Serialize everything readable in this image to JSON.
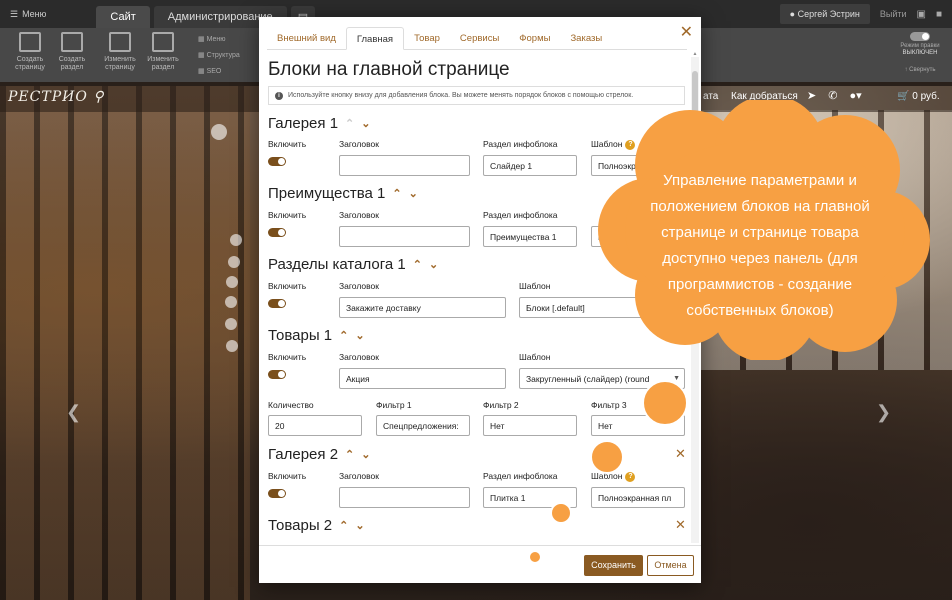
{
  "topbar": {
    "menu_label": "Меню",
    "tabs": [
      {
        "label": "Сайт",
        "active": true
      },
      {
        "label": "Администрирование",
        "active": false
      }
    ],
    "user": "Сергей Эстрин",
    "exit": "Выйти"
  },
  "toolbar": {
    "create_page": "Создать страницу",
    "create_section": "Создать раздел",
    "edit_page": "Изменить страницу",
    "edit_section": "Изменить раздел",
    "menu": "Меню",
    "structure": "Структура",
    "seo": "SEO",
    "edit_mode": "Режим правки",
    "edit_mode_state": "ВЫКЛЮЧЕН",
    "collapse": "Свернуть"
  },
  "site": {
    "logo": "РЕСТРИО",
    "nav_fragment": "ата",
    "nav_link": "Как добраться",
    "cart": "0 руб."
  },
  "modal": {
    "tabs": [
      "Внешний вид",
      "Главная",
      "Товар",
      "Сервисы",
      "Формы",
      "Заказы"
    ],
    "active_tab": "Главная",
    "title": "Блоки на главной странице",
    "info": "Используйте кнопку внизу для добавления блока. Вы можете менять порядок блоков с помощью стрелок.",
    "labels": {
      "enable": "Включить",
      "header": "Заголовок",
      "infoblock": "Раздел инфоблока",
      "template": "Шаблон",
      "quantity": "Количество",
      "filter1": "Фильтр 1",
      "filter2": "Фильтр 2",
      "filter3": "Фильтр 3"
    },
    "blocks": [
      {
        "name": "Галерея 1",
        "header": "",
        "infoblock": "Слайдер 1",
        "template": "Полноэкранн"
      },
      {
        "name": "Преимущества 1",
        "header": "",
        "infoblock": "Преимущества 1",
        "template": "П"
      },
      {
        "name": "Разделы каталога 1",
        "header": "Закажите доставку",
        "template": "Блоки [.default]"
      },
      {
        "name": "Товары 1",
        "header": "Акция",
        "template": "Закругленный (слайдер) (round",
        "quantity": "20",
        "filter1": "Спецпредложения:",
        "filter2": "Нет",
        "filter3": "Нет"
      },
      {
        "name": "Галерея 2",
        "header": "",
        "infoblock": "Плитка 1",
        "template": "Полноэкранная пл"
      },
      {
        "name": "Товары 2"
      }
    ],
    "save": "Сохранить",
    "cancel": "Отмена"
  },
  "callout": {
    "lines": [
      "Управление параметрами и",
      "положением блоков на главной",
      "странице и странице товара",
      "доступно через панель (для",
      "программистов - создание",
      "собственных блоков)"
    ],
    "color": "#f7a043"
  },
  "colors": {
    "accent": "#8a5a22",
    "link": "#a0692a"
  }
}
